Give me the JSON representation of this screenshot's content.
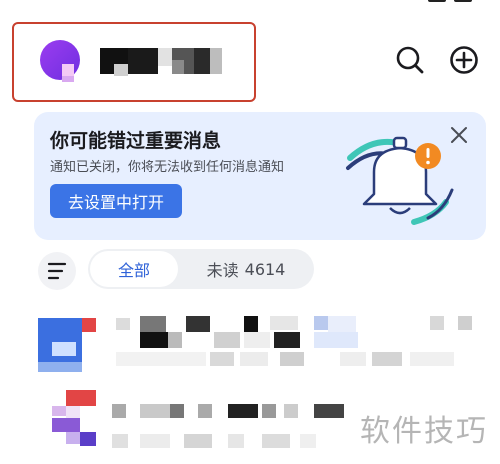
{
  "header": {
    "account_name_redacted": "",
    "icons": [
      "avatar-logo",
      "search-icon",
      "add-icon"
    ]
  },
  "banner": {
    "title": "你可能错过重要消息",
    "subtitle": "通知已关闭，你将无法收到任何消息通知",
    "button_label": "去设置中打开",
    "icons": [
      "bell-icon",
      "close-icon"
    ]
  },
  "filter": {
    "tab_all": "全部",
    "tab_unread_label": "未读",
    "tab_unread_count": "4614",
    "icons": [
      "menu-icon"
    ]
  },
  "watermark": "软件技巧",
  "colors": {
    "accent": "#3b74e6",
    "highlight_border": "#c8412f",
    "banner_bg": "#e7efff",
    "selected_tab_text": "#2f62d8"
  }
}
